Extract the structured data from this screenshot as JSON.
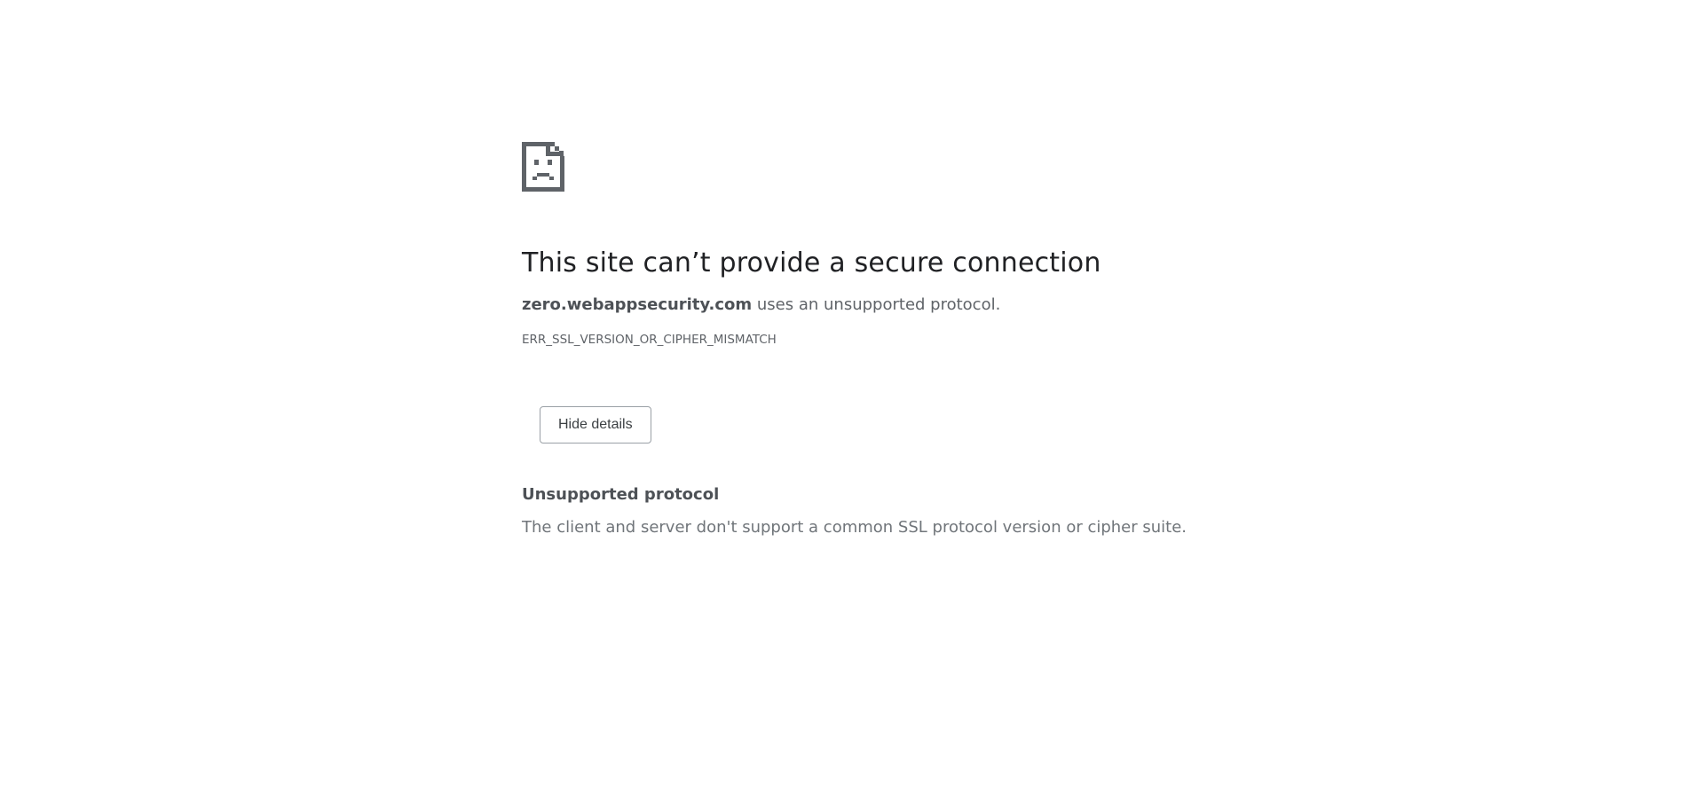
{
  "icon": "sad-page-icon",
  "headline": "This site can’t provide a secure connection",
  "summary": {
    "host": "zero.webappsecurity.com",
    "message": " uses an unsupported protocol."
  },
  "error_code": "ERR_SSL_VERSION_OR_CIPHER_MISMATCH",
  "details_button": {
    "label": "Hide details"
  },
  "details": {
    "heading": "Unsupported protocol",
    "text": "The client and server don't support a common SSL protocol version or cipher suite."
  },
  "colors": {
    "headline": "#202124",
    "body_text": "#5f6368",
    "icon": "#5f6368"
  }
}
